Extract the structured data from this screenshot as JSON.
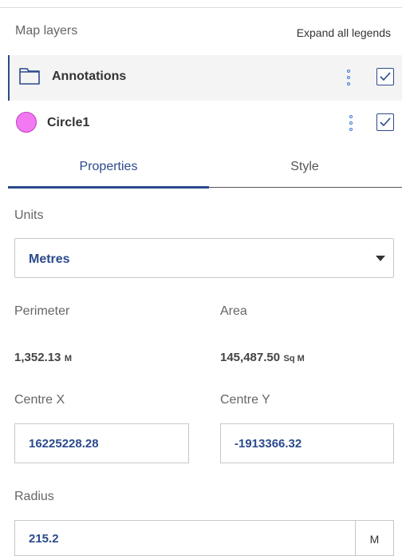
{
  "header": {
    "title": "Map layers",
    "expand_link": "Expand all legends"
  },
  "layers": [
    {
      "label": "Annotations",
      "icon": "folder-icon",
      "checked": true
    },
    {
      "label": "Circle1",
      "icon": "circle-shape-icon",
      "color": "#f279f2",
      "checked": true
    }
  ],
  "tabs": [
    {
      "label": "Properties",
      "active": true
    },
    {
      "label": "Style",
      "active": false
    }
  ],
  "properties": {
    "units_label": "Units",
    "units_value": "Metres",
    "perimeter_label": "Perimeter",
    "perimeter_value": "1,352.13",
    "perimeter_unit": "M",
    "area_label": "Area",
    "area_value": "145,487.50",
    "area_unit": "Sq M",
    "centre_x_label": "Centre X",
    "centre_x_value": "16225228.28",
    "centre_y_label": "Centre Y",
    "centre_y_value": "-1913366.32",
    "radius_label": "Radius",
    "radius_value": "215.2",
    "radius_unit": "M"
  },
  "colors": {
    "accent": "#2b4a8c",
    "circle_fill": "#f279f2"
  }
}
